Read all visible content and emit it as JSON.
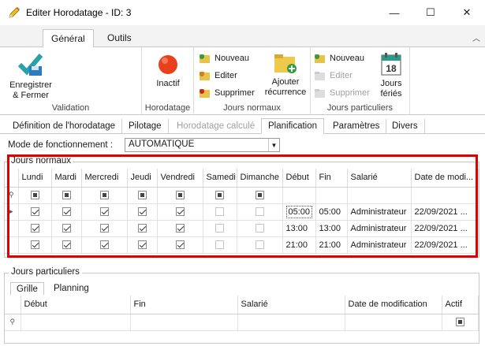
{
  "window": {
    "title": "Editer Horodatage - ID: 3",
    "minimize": "—",
    "maximize": "☐",
    "close": "✕"
  },
  "ribbon_tabs": [
    "Général",
    "Outils"
  ],
  "ribbon": {
    "validation": {
      "save_label_1": "Enregistrer",
      "save_label_2": "& Fermer",
      "group": "Validation"
    },
    "horodatage": {
      "state_label": "Inactif",
      "group": "Horodatage"
    },
    "jours_normaux": {
      "nouveau": "Nouveau",
      "editer": "Editer",
      "supprimer": "Supprimer",
      "ajouter_1": "Ajouter",
      "ajouter_2": "récurrence",
      "group": "Jours normaux"
    },
    "jours_particuliers": {
      "nouveau": "Nouveau",
      "editer": "Editer",
      "supprimer": "Supprimer",
      "feries_num": "18",
      "feries_1": "Jours",
      "feries_2": "fériés",
      "group": "Jours particuliers"
    }
  },
  "form_tabs": [
    "Définition de l'horodatage",
    "Pilotage",
    "Horodatage calculé",
    "Planification",
    "Paramètres",
    "Divers"
  ],
  "mode": {
    "label": "Mode de fonctionnement :",
    "value": "AUTOMATIQUE"
  },
  "jours_normaux": {
    "title": "Jours normaux",
    "columns": [
      "Lundi",
      "Mardi",
      "Mercredi",
      "Jeudi",
      "Vendredi",
      "Samedi",
      "Dimanche",
      "Début",
      "Fin",
      "Salarié",
      "Date de modi..."
    ],
    "rows": [
      {
        "days": [
          true,
          true,
          true,
          true,
          true,
          false,
          false
        ],
        "debut": "05:00",
        "fin": "05:00",
        "salarie": "Administrateur",
        "date": "22/09/2021 ..."
      },
      {
        "days": [
          true,
          true,
          true,
          true,
          true,
          false,
          false
        ],
        "debut": "13:00",
        "fin": "13:00",
        "salarie": "Administrateur",
        "date": "22/09/2021 ..."
      },
      {
        "days": [
          true,
          true,
          true,
          true,
          true,
          false,
          false
        ],
        "debut": "21:00",
        "fin": "21:00",
        "salarie": "Administrateur",
        "date": "22/09/2021 ..."
      }
    ]
  },
  "jours_particuliers": {
    "title": "Jours particuliers",
    "tabs": [
      "Grille",
      "Planning"
    ],
    "columns": [
      "Début",
      "Fin",
      "Salarié",
      "Date de modification",
      "Actif"
    ]
  },
  "colors": {
    "highlight_box": "#e00000",
    "ribbon_bg": "#f3f3f3"
  }
}
